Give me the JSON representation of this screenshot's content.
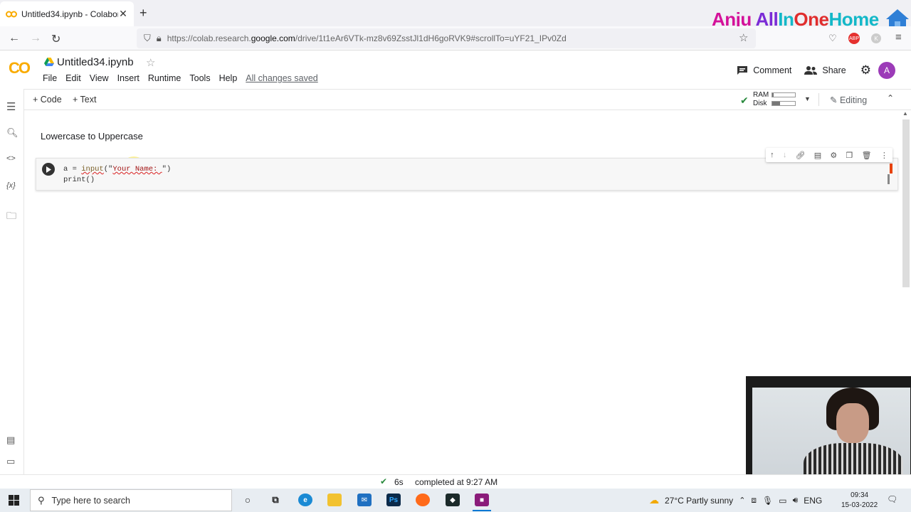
{
  "browser": {
    "tab_title": "Untitled34.ipynb - Colaboratory",
    "tab_close": "✕",
    "new_tab": "+",
    "url_prefix": "https://colab.research.",
    "url_domain": "google.com",
    "url_path": "/drive/1t1eAr6VTk-mz8v69ZsstJl1dH6goRVK9#scrollTo=uYF21_IPv0Zd"
  },
  "overlay": {
    "logo_part1": "Anju ",
    "logo_part2": "All",
    "logo_part3": "In",
    "logo_part4": "One",
    "logo_part5": "Home"
  },
  "colab": {
    "logo": "CO",
    "notebook_title": "Untitled34.ipynb",
    "menu": [
      "File",
      "Edit",
      "View",
      "Insert",
      "Runtime",
      "Tools",
      "Help"
    ],
    "save_status": "All changes saved",
    "comment_label": "Comment",
    "share_label": "Share",
    "avatar_letter": "A"
  },
  "toolbar": {
    "add_code": "+ Code",
    "add_text": "+ Text",
    "ram_label": "RAM",
    "disk_label": "Disk",
    "ram_usage": 0.05,
    "disk_usage": 0.35,
    "editing_label": "Editing"
  },
  "notebook": {
    "section_title": "Lowercase to Uppercase",
    "code_line1_pre": "a = ",
    "code_line1_fn": "input",
    "code_line1_mid": "(\"",
    "code_line1_str": "Your Name: ",
    "code_line1_post": "\")",
    "code_line2": "print()"
  },
  "status": {
    "duration": "6s",
    "message": "completed at 9:27 AM"
  },
  "taskbar": {
    "search_placeholder": "Type here to search",
    "weather": "27°C  Partly sunny",
    "language": "ENG",
    "time": "09:34",
    "date": "15-03-2022"
  },
  "colors": {
    "colab_orange": "#f9ab00",
    "accent_green": "#2a8a3e",
    "avatar_purple": "#9c3bb8"
  }
}
